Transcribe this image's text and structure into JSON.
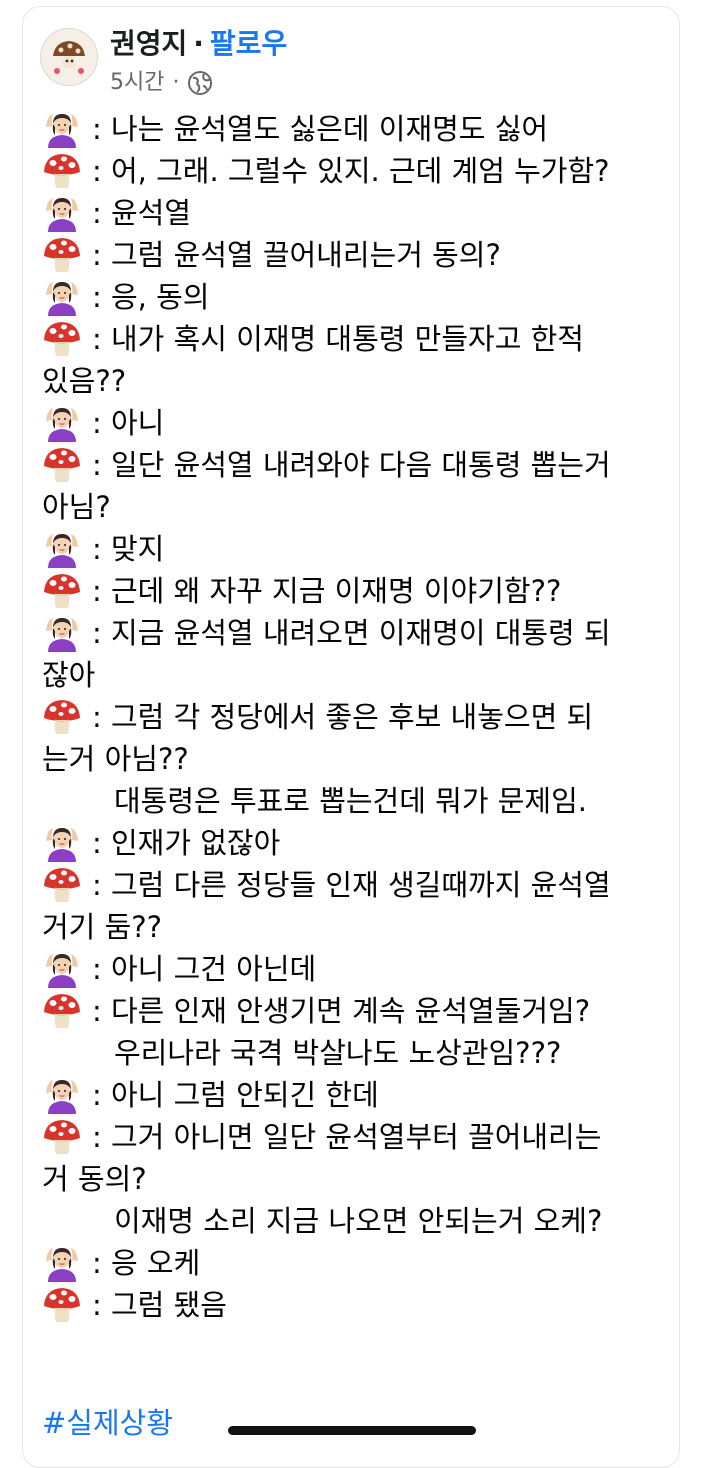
{
  "post": {
    "author": "권영지",
    "separator": "·",
    "follow_label": "팔로우",
    "time": "5시간",
    "time_separator": "·",
    "privacy_icon": "globe-icon",
    "avatar_icon": "mushroom-avatar",
    "hashtag": "#실제상황"
  },
  "icons": {
    "woman": "woman-gesturing-ok-icon",
    "mushroom": "mushroom-icon"
  },
  "colors": {
    "accent": "#1877f2",
    "muted": "#65676b",
    "woman_shirt": "#8a3fc4",
    "mushroom_cap": "#d8342b"
  },
  "lines": [
    {
      "type": "woman",
      "text": ": 나는 윤석열도 싫은데 이재명도 싫어"
    },
    {
      "type": "mushroom",
      "text": ": 어, 그래. 그럴수 있지. 근데 계엄 누가함?"
    },
    {
      "type": "woman",
      "text": ": 윤석열"
    },
    {
      "type": "mushroom",
      "text": ": 그럼 윤석열 끌어내리는거 동의?"
    },
    {
      "type": "woman",
      "text": ": 응, 동의"
    },
    {
      "type": "mushroom",
      "text": ": 내가 혹시 이재명 대통령 만들자고 한적"
    },
    {
      "type": "cont",
      "text": "있음??"
    },
    {
      "type": "woman",
      "text": ": 아니"
    },
    {
      "type": "mushroom",
      "text": ": 일단 윤석열 내려와야 다음 대통령 뽑는거"
    },
    {
      "type": "cont",
      "text": "아님?"
    },
    {
      "type": "woman",
      "text": ": 맞지"
    },
    {
      "type": "mushroom",
      "text": ": 근데 왜 자꾸 지금 이재명 이야기함??"
    },
    {
      "type": "woman",
      "text": ": 지금 윤석열 내려오면 이재명이 대통령 되"
    },
    {
      "type": "cont",
      "text": "잖아"
    },
    {
      "type": "mushroom",
      "text": ": 그럼 각 정당에서 좋은 후보 내놓으면 되"
    },
    {
      "type": "cont",
      "text": "는거 아님??"
    },
    {
      "type": "indent",
      "text": "대통령은 투표로 뽑는건데 뭐가 문제임."
    },
    {
      "type": "woman",
      "text": ": 인재가 없잖아"
    },
    {
      "type": "mushroom",
      "text": ": 그럼 다른 정당들 인재 생길때까지 윤석열"
    },
    {
      "type": "cont",
      "text": "거기 둠??"
    },
    {
      "type": "woman",
      "text": ": 아니 그건 아닌데"
    },
    {
      "type": "mushroom",
      "text": ": 다른 인재 안생기면 계속 윤석열둘거임?"
    },
    {
      "type": "indent",
      "text": "우리나라 국격 박살나도 노상관임???"
    },
    {
      "type": "woman",
      "text": ": 아니 그럼 안되긴 한데"
    },
    {
      "type": "mushroom",
      "text": ": 그거 아니면 일단 윤석열부터 끌어내리는"
    },
    {
      "type": "cont",
      "text": "거 동의?"
    },
    {
      "type": "indent",
      "text": "이재명 소리 지금 나오면 안되는거 오케?"
    },
    {
      "type": "woman",
      "text": ": 응 오케"
    },
    {
      "type": "mushroom",
      "text": ": 그럼 됐음"
    }
  ]
}
